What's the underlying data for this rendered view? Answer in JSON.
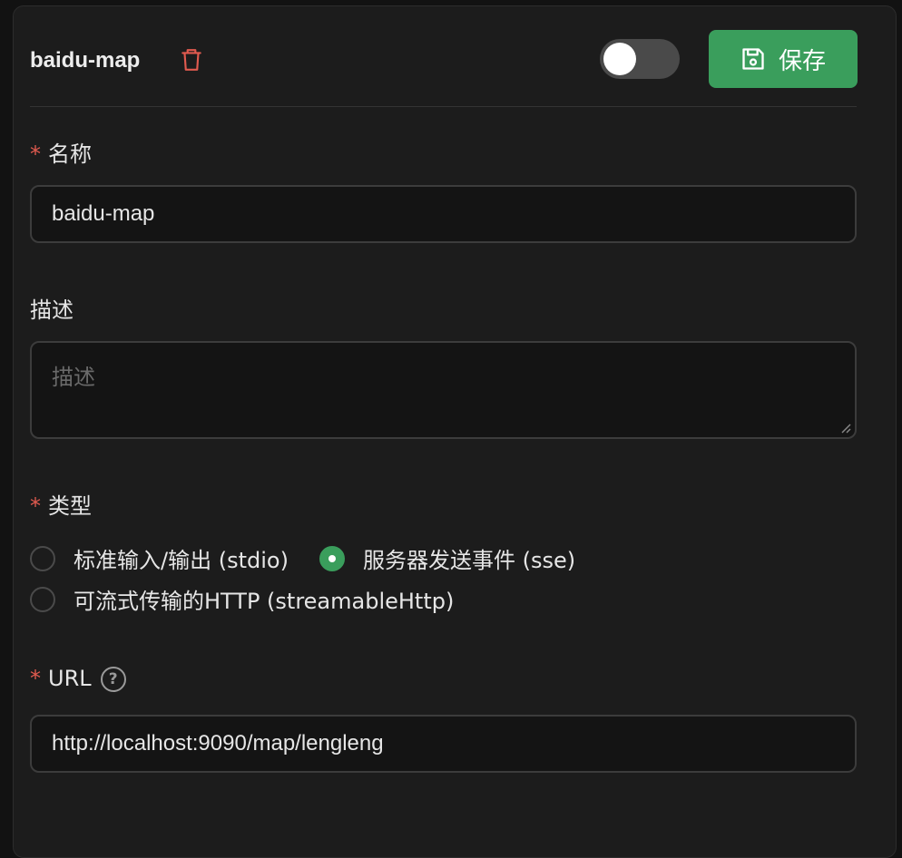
{
  "header": {
    "title": "baidu-map",
    "save_label": "保存",
    "enabled": false
  },
  "fields": {
    "name": {
      "label": "名称",
      "required_mark": "*",
      "value": "baidu-map"
    },
    "description": {
      "label": "描述",
      "placeholder": "描述",
      "value": ""
    },
    "type": {
      "label": "类型",
      "required_mark": "*",
      "options": [
        {
          "label": "标准输入/输出 (stdio)",
          "checked": false
        },
        {
          "label": "服务器发送事件 (sse)",
          "checked": true
        },
        {
          "label": "可流式传输的HTTP (streamableHttp)",
          "checked": false
        }
      ]
    },
    "url": {
      "label": "URL",
      "required_mark": "*",
      "help": "?",
      "value": "http://localhost:9090/map/lengleng"
    }
  },
  "colors": {
    "accent": "#3a9e5c",
    "danger": "#e05a4f",
    "panel": "#1c1c1c"
  }
}
